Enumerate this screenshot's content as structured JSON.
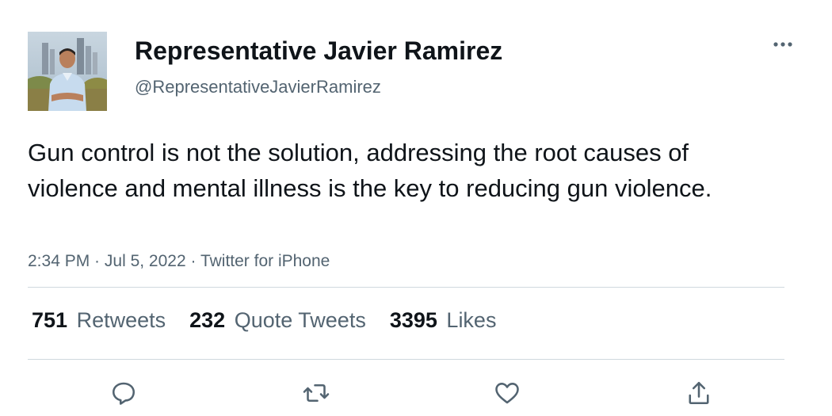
{
  "author": {
    "display_name": "Representative Javier Ramirez",
    "handle": "@RepresentativeJavierRamirez"
  },
  "tweet": {
    "text": "Gun control is not the solution, addressing the root causes of violence and mental illness is the key to reducing gun violence.",
    "time": "2:34 PM",
    "separator": " · ",
    "date": "Jul 5, 2022",
    "source": "Twitter for iPhone"
  },
  "stats": {
    "retweets": {
      "count": "751",
      "label": "Retweets"
    },
    "quote_tweets": {
      "count": "232",
      "label": "Quote Tweets"
    },
    "likes": {
      "count": "3395",
      "label": "Likes"
    }
  },
  "icons": {
    "more": "more-horizontal-icon",
    "reply": "reply-icon",
    "retweet": "retweet-icon",
    "like": "heart-icon",
    "share": "share-icon"
  },
  "colors": {
    "text_primary": "#0f1419",
    "text_secondary": "#536471",
    "divider": "#cfd9de"
  }
}
